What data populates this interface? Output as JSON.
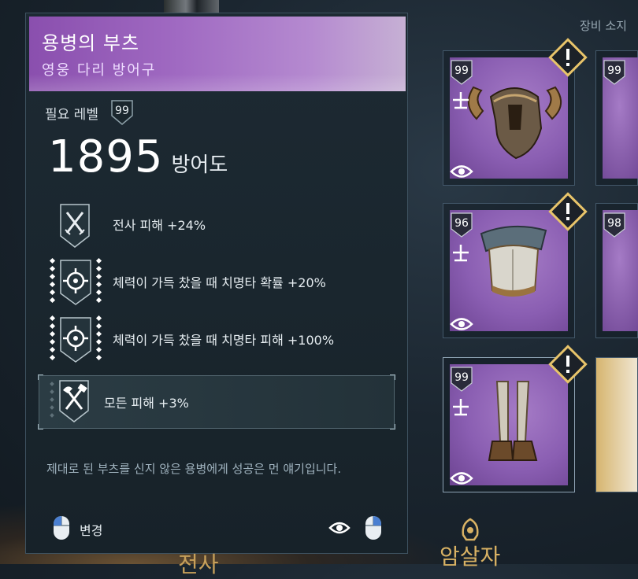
{
  "tooltip": {
    "item_name": "용병의 부츠",
    "item_type": "영웅 다리 방어구",
    "required_level_label": "필요 레벨",
    "required_level": "99",
    "stat_value": "1895",
    "stat_label": "방어도",
    "perks": [
      {
        "text": "전사 피해 +24%",
        "icon": "crossed-swords-icon"
      },
      {
        "text": "체력이 가득 찼을 때 치명타 확률 +20%",
        "icon": "crosshair-icon"
      },
      {
        "text": "체력이 가득 찼을 때 치명타 피해 +100%",
        "icon": "crosshair-icon"
      },
      {
        "text": "모든 피해 +3%",
        "icon": "crossed-axe-hammer-icon",
        "selected": true
      }
    ],
    "description": "제대로 된 부츠를 신지 않은 용병에게 성공은 먼 얘기입니다.",
    "footer": {
      "change_label": "변경"
    }
  },
  "equipment": {
    "section_label": "장비 소지",
    "slots": [
      {
        "level": "99",
        "item": "horned-helmet",
        "alert": true
      },
      {
        "level": "96",
        "item": "chest-armor",
        "alert": true
      },
      {
        "level": "99",
        "item": "leg-armor",
        "alert": true
      }
    ],
    "partial_slots": [
      {
        "level": "99"
      },
      {
        "level": "98"
      }
    ]
  },
  "class_labels": {
    "bottom_right": "암살자",
    "bottom_left": "전사"
  },
  "colors": {
    "epic_purple": "#8a5eb2",
    "alert_gold": "#e8c46a",
    "accent_border": "#43586a"
  }
}
